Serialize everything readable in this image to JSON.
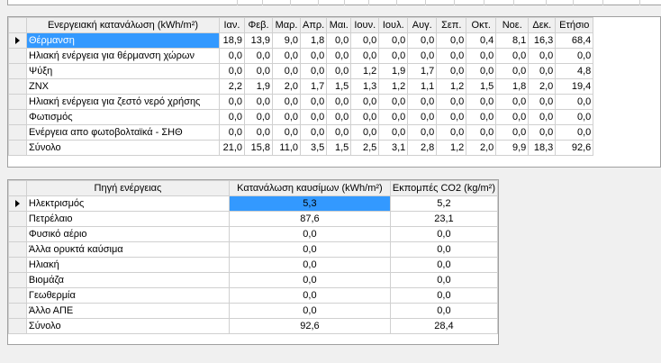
{
  "energy_table": {
    "headers": [
      "Ενεργειακή κατανάλωση (kWh/m²)",
      "Ιαν.",
      "Φεβ.",
      "Μαρ.",
      "Απρ.",
      "Μαι.",
      "Ιουν.",
      "Ιουλ.",
      "Αυγ.",
      "Σεπ.",
      "Οκτ.",
      "Νοε.",
      "Δεκ.",
      "Ετήσιο"
    ],
    "rows": [
      [
        "Θέρμανση",
        "18,9",
        "13,9",
        "9,0",
        "1,8",
        "0,0",
        "0,0",
        "0,0",
        "0,0",
        "0,0",
        "0,4",
        "8,1",
        "16,3",
        "68,4"
      ],
      [
        "Ηλιακή ενέργεια για θέρμανση χώρων",
        "0,0",
        "0,0",
        "0,0",
        "0,0",
        "0,0",
        "0,0",
        "0,0",
        "0,0",
        "0,0",
        "0,0",
        "0,0",
        "0,0",
        "0,0"
      ],
      [
        "Ψύξη",
        "0,0",
        "0,0",
        "0,0",
        "0,0",
        "0,0",
        "1,2",
        "1,9",
        "1,7",
        "0,0",
        "0,0",
        "0,0",
        "0,0",
        "4,8"
      ],
      [
        "ΖΝΧ",
        "2,2",
        "1,9",
        "2,0",
        "1,7",
        "1,5",
        "1,3",
        "1,2",
        "1,1",
        "1,2",
        "1,5",
        "1,8",
        "2,0",
        "19,4"
      ],
      [
        "Ηλιακή ενέργεια για ζεστό νερό χρήσης",
        "0,0",
        "0,0",
        "0,0",
        "0,0",
        "0,0",
        "0,0",
        "0,0",
        "0,0",
        "0,0",
        "0,0",
        "0,0",
        "0,0",
        "0,0"
      ],
      [
        "Φωτισμός",
        "0,0",
        "0,0",
        "0,0",
        "0,0",
        "0,0",
        "0,0",
        "0,0",
        "0,0",
        "0,0",
        "0,0",
        "0,0",
        "0,0",
        "0,0"
      ],
      [
        "Ενέργεια απο φωτοβολταϊκά - ΣΗΘ",
        "0,0",
        "0,0",
        "0,0",
        "0,0",
        "0,0",
        "0,0",
        "0,0",
        "0,0",
        "0,0",
        "0,0",
        "0,0",
        "0,0",
        "0,0"
      ],
      [
        "Σύνολο",
        "21,0",
        "15,8",
        "11,0",
        "3,5",
        "1,5",
        "2,5",
        "3,1",
        "2,8",
        "1,2",
        "2,0",
        "9,9",
        "18,3",
        "92,6"
      ]
    ]
  },
  "source_table": {
    "headers": [
      "Πηγή ενέργειας",
      "Κατανάλωση καυσίμων (kWh/m²)",
      "Εκπομπές CO2 (kg/m²)"
    ],
    "rows": [
      [
        "Ηλεκτρισμός",
        "5,3",
        "5,2"
      ],
      [
        "Πετρέλαιο",
        "87,6",
        "23,1"
      ],
      [
        "Φυσικό αέριο",
        "0,0",
        "0,0"
      ],
      [
        "Άλλα ορυκτά καύσιμα",
        "0,0",
        "0,0"
      ],
      [
        "Ηλιακή",
        "0,0",
        "0,0"
      ],
      [
        "Βιομάζα",
        "0,0",
        "0,0"
      ],
      [
        "Γεωθερμία",
        "0,0",
        "0,0"
      ],
      [
        "Άλλο ΑΠΕ",
        "0,0",
        "0,0"
      ],
      [
        "Σύνολο",
        "92,6",
        "28,4"
      ]
    ]
  },
  "colors": {
    "selection": "#3399ff",
    "header_bg": "#f0f0f0",
    "grid_line": "#d0d0d0"
  },
  "icons": {
    "current_row": "row-pointer-icon"
  }
}
